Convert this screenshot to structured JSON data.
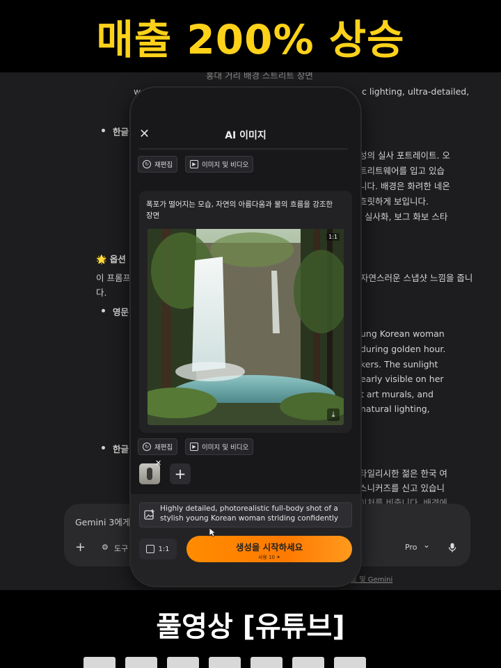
{
  "banner_top": "매출 200% 상승",
  "banner_bottom": "풀영상 [유튜브]",
  "background_chat": {
    "lines_right": [
      "성의 실사 포트레이트. 오",
      "트리트웨어를 입고 있습",
      "니다. 배경은 화려한 네온",
      "흐릿하게 보입니다.",
      ", 실사화, 보그 화보 스타"
    ],
    "lines_right_en": [
      "ung Korean woman",
      "during golden hour.",
      "kers. The sunlight",
      "early visible on her",
      "t art murals, and",
      "natural lighting,"
    ],
    "lines_right_bottom": [
      "타일리시한 젊은 한국 여",
      "스니커즈를 신고 있습니",
      "이처를 비춥니다. 배경에"
    ],
    "top_line": "홍대 거리 배경 스트리트 장면",
    "top_line_right": "c lighting, ultra-detailed,",
    "top_line_left": "w",
    "bullet1": "한글",
    "option2": "🌟 옵션 2:",
    "desc_left": "이 프롬프트",
    "desc_right": "자연스러운 스냅샷 느낌을 줍니",
    "desc_cont": "다.",
    "bullet2": "영문",
    "bullet3": "한글",
    "footer_link": "호 및 Gemini",
    "chat_placeholder": "Gemini 3에게 물",
    "tools_label": "도구",
    "plus_label": "+",
    "model_label": "Pro",
    "model_chevron": "⌄",
    "mic_icon": "mic-icon"
  },
  "phone": {
    "close_icon": "close-icon",
    "close_glyph": "✕",
    "title": "AI 이미지",
    "chip_reedit": "재편집",
    "chip_image_video": "이미지 및 비디오",
    "prompt_text": "폭포가 떨어지는 모습, 자연의 아름다움과 물의 흐름을 강조한 장면",
    "image_badge": "1:1",
    "download_icon": "download-icon",
    "add_glyph": "+",
    "input_text": "Highly detailed, photorealistic full-body shot of a stylish young Korean woman striding confidently",
    "ratio_label": "1:1",
    "generate_label": "생성을 시작하세요",
    "generate_sub": "사용 10 ✦",
    "accent_color": "#ff8c00"
  }
}
